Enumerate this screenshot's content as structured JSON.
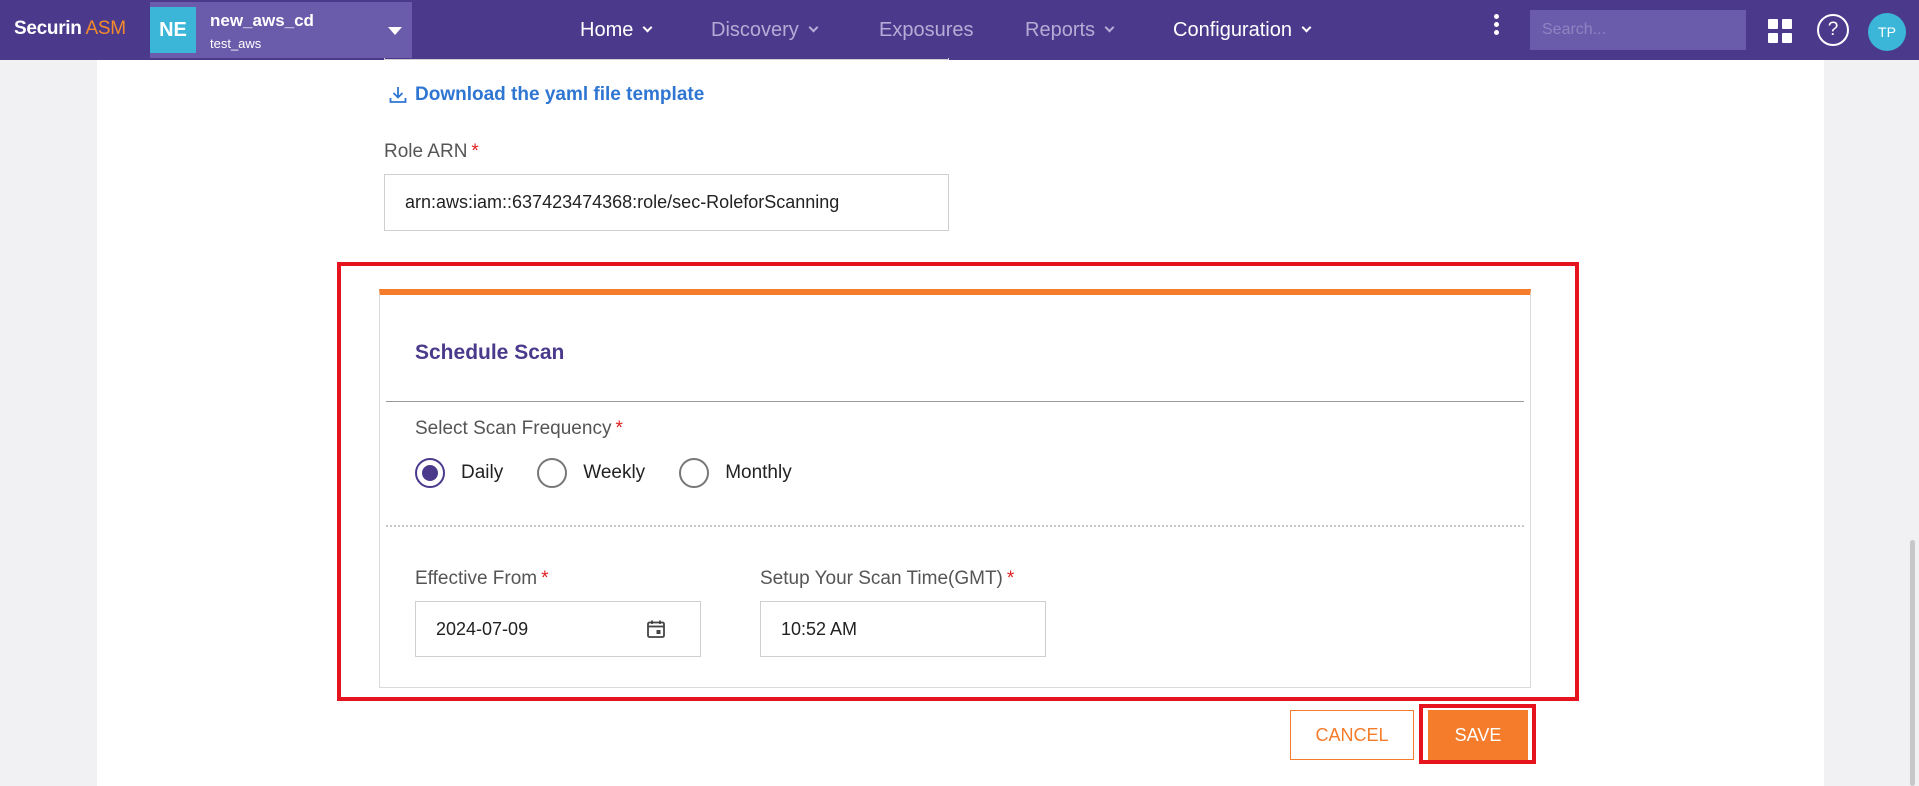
{
  "header": {
    "brand_main": "Securin",
    "brand_accent": " ASM",
    "project": {
      "badge": "NE",
      "name": "new_aws_cd",
      "subtitle": "test_aws"
    },
    "nav": [
      {
        "label": "Home",
        "has_caret": true,
        "active": true
      },
      {
        "label": "Discovery",
        "has_caret": true,
        "active": false
      },
      {
        "label": "Exposures",
        "has_caret": false,
        "active": false
      },
      {
        "label": "Reports",
        "has_caret": true,
        "active": false
      },
      {
        "label": "Configuration",
        "has_caret": true,
        "active": true
      }
    ],
    "search_placeholder": "Search...",
    "avatar_initials": "TP",
    "help_glyph": "?"
  },
  "form": {
    "download_link": "Download the yaml file template",
    "role_arn": {
      "label": "Role ARN",
      "required_mark": "*",
      "value": "arn:aws:iam::637423474368:role/sec-RoleforScanning"
    }
  },
  "schedule": {
    "title": "Schedule Scan",
    "frequency": {
      "label": "Select Scan Frequency",
      "required_mark": "*",
      "options": [
        "Daily",
        "Weekly",
        "Monthly"
      ],
      "selected": "Daily"
    },
    "effective_from": {
      "label": "Effective From",
      "required_mark": "*",
      "value": "2024-07-09"
    },
    "scan_time": {
      "label": "Setup Your Scan Time(GMT)",
      "required_mark": "*",
      "value": "10:52 AM"
    }
  },
  "actions": {
    "cancel_label": "CANCEL",
    "save_label": "SAVE"
  },
  "colors": {
    "header_bg": "#4b3a8c",
    "accent_orange": "#f47c2b",
    "link_blue": "#2f76d2",
    "highlight_red": "#e6141e",
    "badge_cyan": "#3bb6d9"
  },
  "icons": {
    "download": "download-icon",
    "calendar": "calendar-icon",
    "apps": "apps-grid-icon",
    "help": "help-icon",
    "more": "more-vertical-icon"
  }
}
